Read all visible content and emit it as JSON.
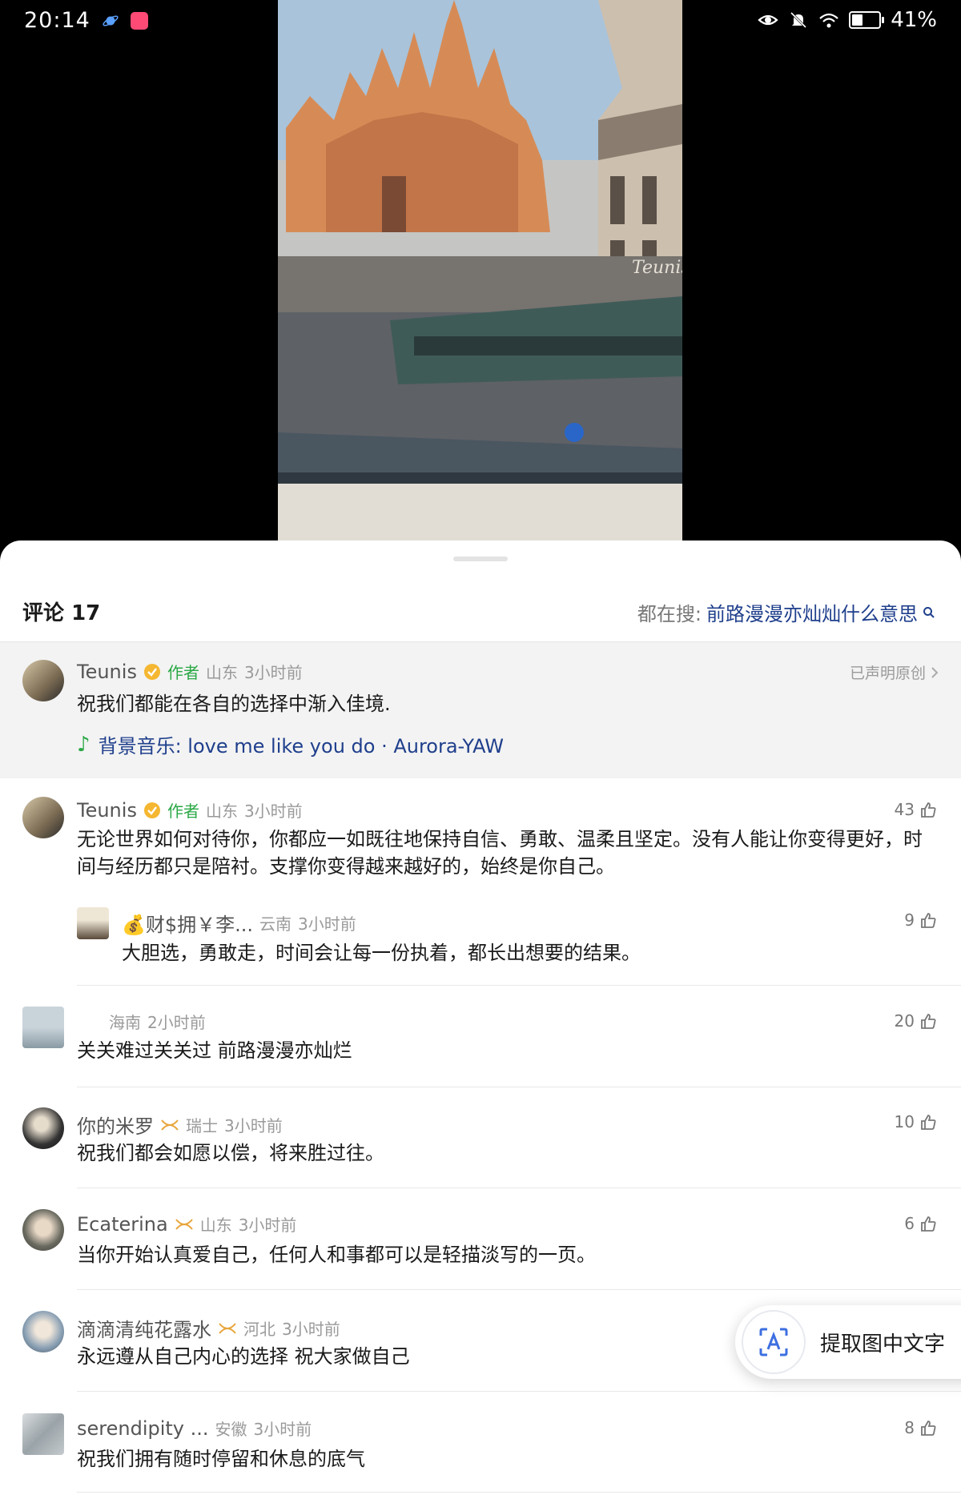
{
  "status_bar": {
    "time": "20:14",
    "battery": "41%",
    "battery_level": 0.41
  },
  "video": {
    "watermark": "Teunis"
  },
  "comments_header": {
    "title": "评论",
    "count": "17",
    "search_prefix": "都在搜:",
    "search_term": "前路漫漫亦灿灿什么意思"
  },
  "pinned": {
    "username": "Teunis",
    "author_tag": "作者",
    "location": "山东",
    "time": "3小时前",
    "declared_label": "已声明原创",
    "text": "祝我们都能在各自的选择中渐入佳境.",
    "music": "背景音乐: love me like you do · Aurora-YAW"
  },
  "comments": [
    {
      "username": "Teunis",
      "author_tag": "作者",
      "location": "山东",
      "time": "3小时前",
      "likes": "43",
      "text": "无论世界如何对待你，你都应一如既往地保持自信、勇敢、温柔且坚定。没有人能让你变得更好，时间与经历都只是陪衬。支撑你变得越来越好的，始终是你自己。"
    },
    {
      "username": "💰财$拥￥李...",
      "location": "云南",
      "time": "3小时前",
      "likes": "9",
      "text": "大胆选，勇敢走，时间会让每一份执着，都长出想要的结果。"
    },
    {
      "username": "",
      "location": "海南",
      "time": "2小时前",
      "likes": "20",
      "text": "关关难过关关过 前路漫漫亦灿烂"
    },
    {
      "username": "你的米罗",
      "location": "瑞士",
      "time": "3小时前",
      "likes": "10",
      "text": "祝我们都会如愿以偿，将来胜过往。"
    },
    {
      "username": "Ecaterina",
      "location": "山东",
      "time": "3小时前",
      "likes": "6",
      "text": "当你开始认真爱自己，任何人和事都可以是轻描淡写的一页。"
    },
    {
      "username": "滴滴清纯花露水",
      "location": "河北",
      "time": "3小时前",
      "likes": "",
      "text": "永远遵从自己内心的选择 祝大家做自己"
    },
    {
      "username": "serendipity ...",
      "location": "安徽",
      "time": "3小时前",
      "likes": "8",
      "text": "祝我们拥有随时停留和休息的底气"
    }
  ],
  "ocr_button": {
    "label": "提取图中文字"
  },
  "colors": {
    "author_green": "#2aa845",
    "link_blue": "#1f3f8c",
    "vip_gold": "#e8a53a",
    "verify_gold": "#f5b731"
  },
  "icons": [
    "eye-icon",
    "bell-off-icon",
    "wifi-icon",
    "battery-icon",
    "verify-badge-icon",
    "vip-icon",
    "like-icon",
    "search-icon",
    "chevron-right-icon",
    "music-note-icon",
    "ocr-scan-icon"
  ]
}
